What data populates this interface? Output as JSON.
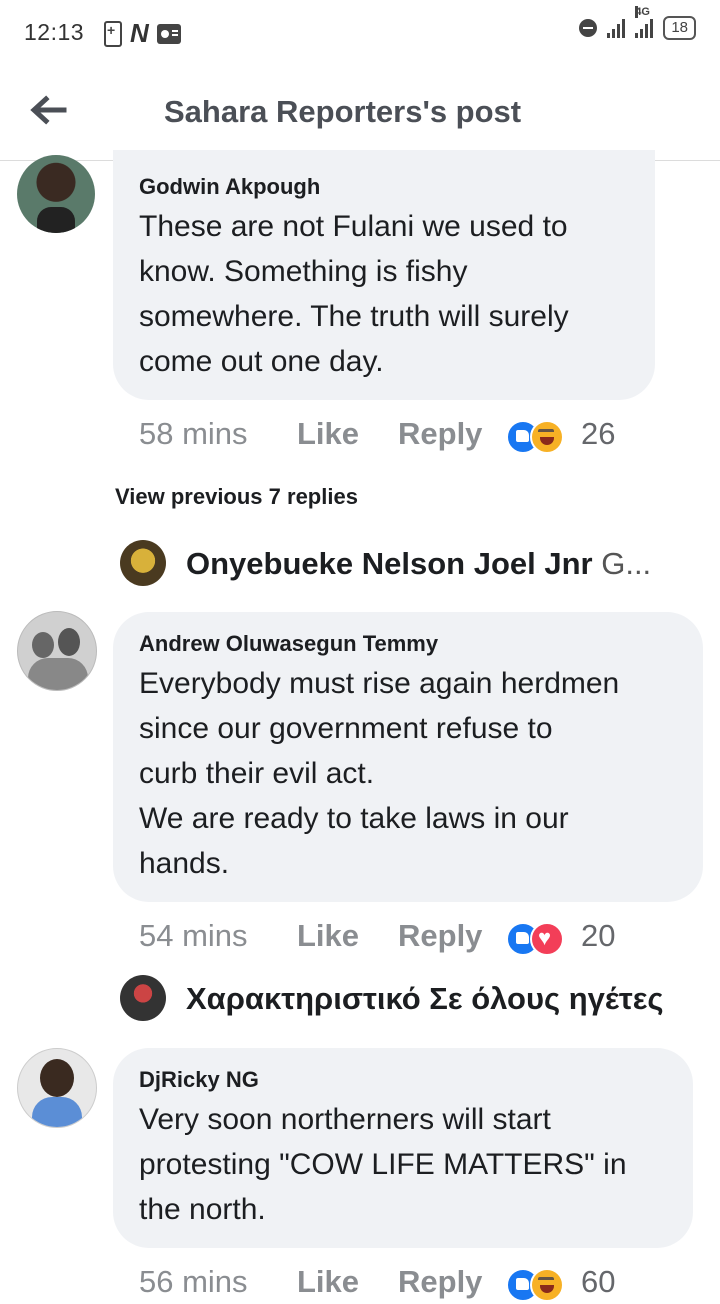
{
  "status_bar": {
    "time": "12:13",
    "network": "4G",
    "battery": "18",
    "icons": [
      "battery-saver-icon",
      "n-app-icon",
      "radio-icon",
      "dnd-icon",
      "signal-icon"
    ]
  },
  "header": {
    "title": "Sahara Reporters's post",
    "back_icon": "arrow-left-icon"
  },
  "comments": [
    {
      "author": "Godwin Akpough",
      "lines": [
        "These are not Fulani we used to",
        "know. Something is fishy",
        "somewhere. The truth will surely",
        "come out one day."
      ],
      "time": "58 mins",
      "like": "Like",
      "reply": "Reply",
      "reactions": [
        "like",
        "haha"
      ],
      "reaction_count": "26"
    },
    {
      "author": "Andrew Oluwasegun Temmy",
      "lines": [
        "Everybody must rise again herdmen",
        "since our government refuse to",
        "curb their evil act.",
        "We are ready to take laws in our",
        "hands."
      ],
      "time": "54 mins",
      "like": "Like",
      "reply": "Reply",
      "reactions": [
        "like",
        "love"
      ],
      "reaction_count": "20"
    },
    {
      "author": "DjRicky NG",
      "lines": [
        "Very soon northerners will start",
        "protesting \"COW LIFE MATTERS\" in",
        "the north."
      ],
      "time": "56 mins",
      "like": "Like",
      "reply": "Reply",
      "reactions": [
        "like",
        "haha"
      ],
      "reaction_count": "60"
    }
  ],
  "view_previous": "View previous 7 replies",
  "reply_previews": [
    {
      "name": "Onyebueke Nelson Joel Jnr",
      "rest": "G..."
    },
    {
      "name": "Χαρακτηριστικό Σε όλους ηγέτες",
      "rest": ""
    }
  ]
}
